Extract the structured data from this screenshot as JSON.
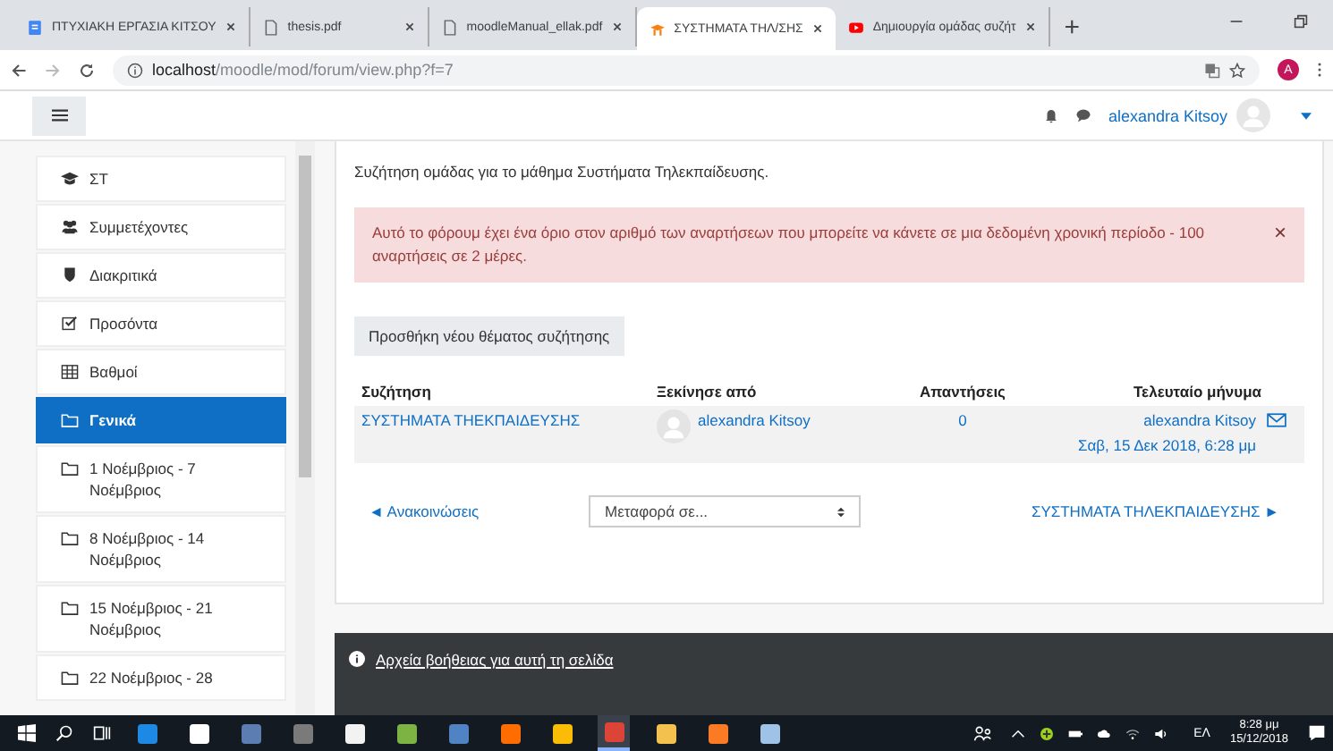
{
  "browser": {
    "tabs": [
      {
        "kind": "doc",
        "title": "ΠΤΥΧΙΑΚΗ ΕΡΓΑΣΙΑ ΚΙΤΣΟΥ",
        "selected": false
      },
      {
        "kind": "pdf",
        "title": "thesis.pdf",
        "selected": false
      },
      {
        "kind": "pdf",
        "title": "moodleManual_ellak.pdf",
        "selected": false
      },
      {
        "kind": "moodle",
        "title": "ΣΥΣΤΗΜΑΤΑ ΤΗΛ/ΣΗΣ",
        "selected": true
      },
      {
        "kind": "video",
        "title": "Δημιουργία ομάδας συζήτ",
        "selected": false
      }
    ],
    "new_tab": "+",
    "address": {
      "host": "localhost",
      "path": "/moodle/mod/forum/view.php?f=7"
    },
    "profile_initial": "A"
  },
  "navbar": {
    "user": "alexandra Kitsoy"
  },
  "sidebar": {
    "items": [
      {
        "kind": "course",
        "label": "ΣΤ",
        "selected": false
      },
      {
        "kind": "users",
        "label": "Συμμετέχοντες",
        "selected": false
      },
      {
        "kind": "badge",
        "label": "Διακριτικά",
        "selected": false
      },
      {
        "kind": "check",
        "label": "Προσόντα",
        "selected": false
      },
      {
        "kind": "grid",
        "label": "Βαθμοί",
        "selected": false
      },
      {
        "kind": "folder",
        "label": "Γενικά",
        "selected": true
      },
      {
        "kind": "folder",
        "label": "1 Νοέμβριος - 7 Νοέμβριος",
        "selected": false
      },
      {
        "kind": "folder",
        "label": "8 Νοέμβριος - 14 Νοέμβριος",
        "selected": false
      },
      {
        "kind": "folder",
        "label": "15 Νοέμβριος - 21 Νοέμβριος",
        "selected": false
      },
      {
        "kind": "folder",
        "label": "22 Νοέμβριος - 28",
        "selected": false
      }
    ]
  },
  "content": {
    "intro": "Συζήτηση ομάδας για το μάθημα Συστήματα Τηλεκπαίδευσης.",
    "alert": {
      "text": "Αυτό το φόρουμ έχει ένα όριο στον αριθμό των αναρτήσεων που μπορείτε να κάνετε σε μια δεδομένη χρονική περίοδο - 100 αναρτήσεις σε 2 μέρες.",
      "close": "×"
    },
    "add_button": "Προσθήκη νέου θέματος συζήτησης",
    "table": {
      "columns": [
        "Συζήτηση",
        "Ξεκίνησε από",
        "Απαντήσεις",
        "Τελευταίο μήνυμα"
      ],
      "rows": [
        {
          "discussion": "ΣΥΣΤΗΜΑΤΑ ΤΗΕΚΠΑΙΔΕΥΣΗΣ",
          "started_by": "alexandra Kitsoy",
          "replies": "0",
          "last_author": "alexandra Kitsoy",
          "last_date": "Σαβ, 15 Δεκ 2018, 6:28 μμ"
        }
      ]
    },
    "prev_link": "◄ Ανακοινώσεις",
    "jump_select": "Μεταφορά σε...",
    "next_link": "ΣΥΣΤΗΜΑΤΑ ΤΗΛΕΚΠΑΙΔΕΥΣΗΣ ►"
  },
  "footer": {
    "help_link": "Αρχεία βοήθειας για αυτή τη σελίδα"
  },
  "taskbar": {
    "apps": [
      {
        "selected": false
      },
      {
        "selected": false
      },
      {
        "selected": false
      },
      {
        "selected": false
      },
      {
        "selected": false
      },
      {
        "selected": false
      },
      {
        "selected": false
      },
      {
        "selected": false
      },
      {
        "selected": false
      },
      {
        "selected": true
      },
      {
        "selected": false
      },
      {
        "selected": false
      },
      {
        "selected": false
      }
    ],
    "language": "ΕΛ",
    "time": "8:28 μμ",
    "date": "15/12/2018"
  }
}
